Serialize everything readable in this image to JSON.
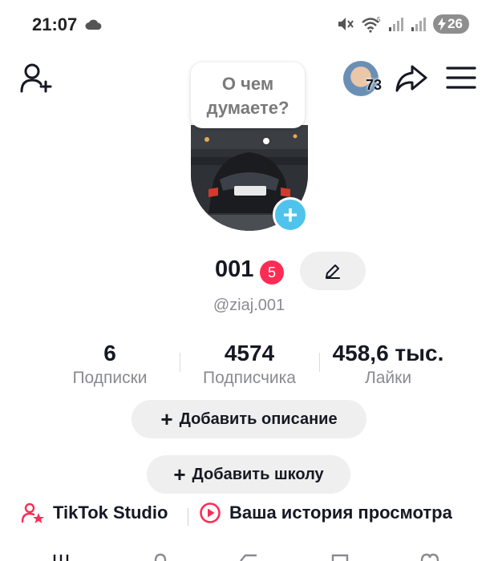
{
  "status_bar": {
    "time": "21:07",
    "battery": "26",
    "icons": [
      "cloud-icon",
      "mute-icon",
      "wifi-icon",
      "signal-icon",
      "signal-icon",
      "battery-charging-icon"
    ]
  },
  "header": {
    "friends_count": "73"
  },
  "bubble": {
    "line1": "О чем",
    "line2": "думаете?"
  },
  "profile": {
    "nickname": "001",
    "badge": "5",
    "username": "@ziaj.001"
  },
  "stats": [
    {
      "value": "6",
      "label": "Подписки"
    },
    {
      "value": "4574",
      "label": "Подписчика"
    },
    {
      "value": "458,6 тыс.",
      "label": "Лайки"
    }
  ],
  "buttons": {
    "add_bio": "Добавить описание",
    "add_school": "Добавить школу"
  },
  "links": {
    "studio": "TikTok Studio",
    "history": "Ваша история просмотра"
  },
  "colors": {
    "accent_red": "#fe2c55",
    "accent_blue": "#4fc3ec",
    "muted_text": "#8a8b91"
  }
}
